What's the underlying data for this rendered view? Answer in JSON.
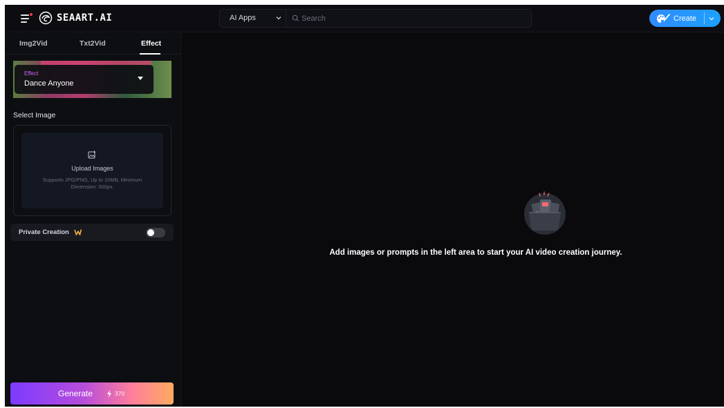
{
  "header": {
    "logo_text": "SEAART.AI",
    "apps_select": "AI Apps",
    "search_placeholder": "Search",
    "create_label": "Create",
    "accent_color": "#2f8cff"
  },
  "tabs": [
    {
      "label": "Img2Vid",
      "active": false
    },
    {
      "label": "Txt2Vid",
      "active": false
    },
    {
      "label": "Effect",
      "active": true
    }
  ],
  "effect": {
    "caption": "Effect",
    "value": "Dance Anyone"
  },
  "upload": {
    "section_label": "Select Image",
    "title": "Upload Images",
    "hint": "Supports JPG/PNG, Up to 10MB, Minimum Dimension: 300px."
  },
  "private_creation": {
    "label": "Private Creation",
    "enabled": false
  },
  "generate": {
    "label": "Generate",
    "cost": "370"
  },
  "main": {
    "empty_message": "Add images or prompts in the left area to start your AI video creation journey."
  },
  "icons": [
    "menu-icon",
    "logo-icon",
    "chevron-down-icon",
    "search-icon",
    "palette-brush-icon",
    "image-upload-icon",
    "pro-badge-icon",
    "bolt-icon",
    "empty-folder-illustration"
  ]
}
